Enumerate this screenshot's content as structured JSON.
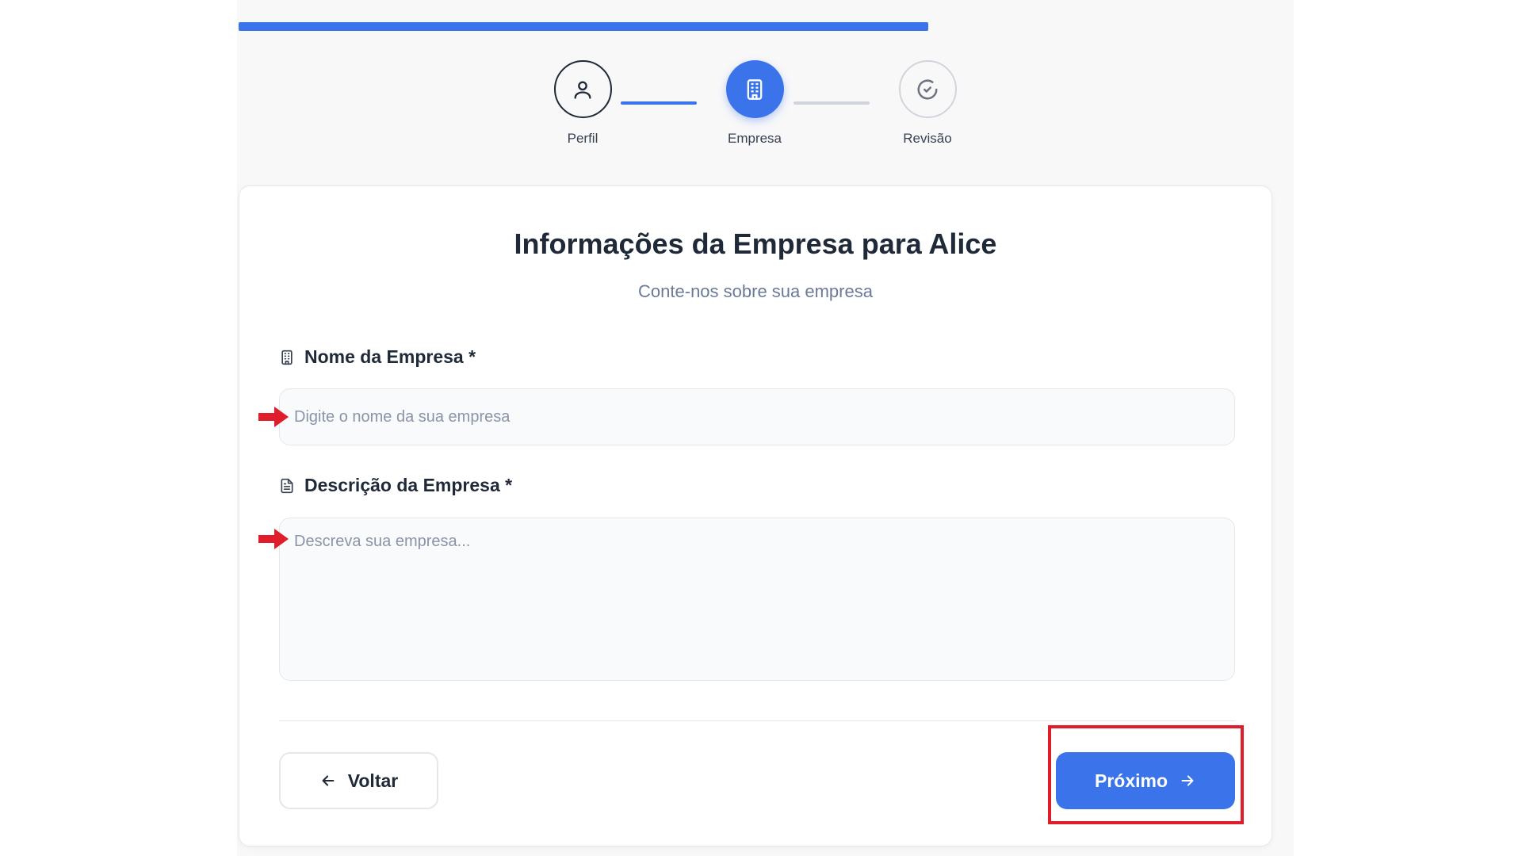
{
  "progress": {
    "fraction": 0.655
  },
  "stepper": {
    "steps": [
      {
        "label": "Perfil",
        "icon": "user-icon",
        "state": "completed"
      },
      {
        "label": "Empresa",
        "icon": "building-icon",
        "state": "active"
      },
      {
        "label": "Revisão",
        "icon": "check-circle-icon",
        "state": "pending"
      }
    ]
  },
  "form": {
    "title": "Informações da Empresa para Alice",
    "subtitle": "Conte-nos sobre sua empresa",
    "company_name": {
      "label": "Nome da Empresa *",
      "icon": "building-icon",
      "value": "",
      "placeholder": "Digite o nome da sua empresa"
    },
    "company_description": {
      "label": "Descrição da Empresa *",
      "icon": "document-icon",
      "value": "",
      "placeholder": "Descreva sua empresa..."
    },
    "back_button": {
      "label": "Voltar",
      "icon": "arrow-left-icon"
    },
    "next_button": {
      "label": "Próximo",
      "icon": "arrow-right-icon"
    }
  },
  "colors": {
    "accent": "#3b74ea",
    "annotation_red": "#e01e2b",
    "pending_gray": "#d1d5db"
  }
}
